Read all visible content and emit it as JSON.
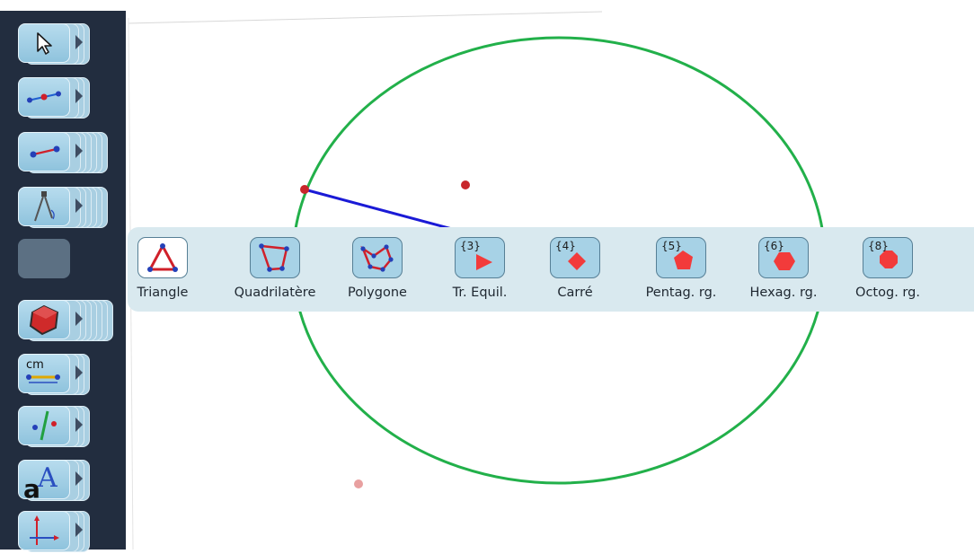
{
  "toolbar": {
    "tools": [
      {
        "id": "pointer",
        "icon": "arrow-pointer-icon"
      },
      {
        "id": "point",
        "icon": "point-on-line-icon"
      },
      {
        "id": "segment",
        "icon": "segment-icon"
      },
      {
        "id": "compass",
        "icon": "compass-icon"
      },
      {
        "id": "empty",
        "icon": ""
      },
      {
        "id": "polygon",
        "icon": "polygon-icon"
      },
      {
        "id": "measure",
        "icon": "measure-cm-icon",
        "label": "cm"
      },
      {
        "id": "transform",
        "icon": "symmetry-icon"
      },
      {
        "id": "text",
        "icon": "text-tool-icon"
      },
      {
        "id": "axes",
        "icon": "axes-icon"
      }
    ]
  },
  "palette": {
    "items": [
      {
        "label": "Triangle",
        "icon": "triangle-icon",
        "badge": ""
      },
      {
        "label": "Quadrilatère",
        "icon": "quadrilateral-icon",
        "badge": ""
      },
      {
        "label": "Polygone",
        "icon": "polygon-shape-icon",
        "badge": ""
      },
      {
        "label": "Tr. Equil.",
        "icon": "equilateral-triangle-icon",
        "badge": "{3}"
      },
      {
        "label": "Carré",
        "icon": "square-icon",
        "badge": "{4}"
      },
      {
        "label": "Pentag. rg.",
        "icon": "pentagon-icon",
        "badge": "{5}"
      },
      {
        "label": "Hexag. rg.",
        "icon": "hexagon-icon",
        "badge": "{6}"
      },
      {
        "label": "Octog. rg.",
        "icon": "octagon-icon",
        "badge": "{8}"
      }
    ]
  },
  "colors": {
    "sidebar": "#222d3f",
    "circle": "#22b04a",
    "segment": "#1a1ad6",
    "point": "#c8262b",
    "palette_bg": "#d9e9ef",
    "button": "#a7d2e6"
  }
}
